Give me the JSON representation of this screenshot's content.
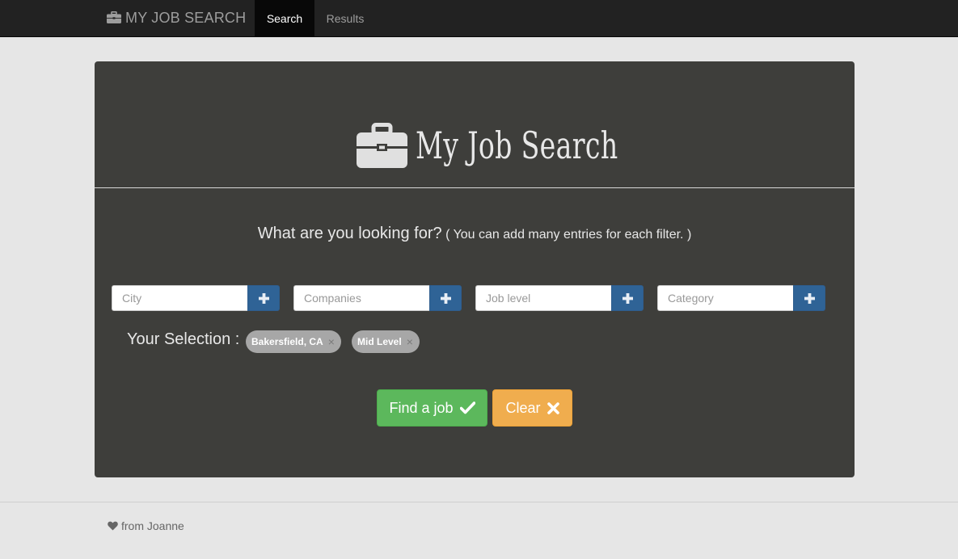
{
  "navbar": {
    "brand": "MY JOB SEARCH",
    "brand_icon": "briefcase-icon",
    "tabs": [
      {
        "label": "Search",
        "active": true
      },
      {
        "label": "Results",
        "active": false
      }
    ]
  },
  "hero": {
    "logo_text": "My Job Search",
    "logo_icon": "briefcase-icon"
  },
  "question": {
    "main": "What are you looking for?",
    "hint": "( You can add many entries for each filter. )"
  },
  "filters": [
    {
      "placeholder": "City",
      "value": "",
      "button_icon": "plus-icon"
    },
    {
      "placeholder": "Companies",
      "value": "",
      "button_icon": "plus-icon"
    },
    {
      "placeholder": "Job level",
      "value": "",
      "button_icon": "plus-icon"
    },
    {
      "placeholder": "Category",
      "value": "",
      "button_icon": "plus-icon"
    }
  ],
  "selection": {
    "label": "Your Selection :",
    "chips": [
      {
        "label": "Bakersfield, CA",
        "remove": "×"
      },
      {
        "label": "Mid Level",
        "remove": "×"
      }
    ]
  },
  "actions": {
    "find_label": "Find a job",
    "find_icon": "check-icon",
    "clear_label": "Clear",
    "clear_icon": "close-icon"
  },
  "footer": {
    "text": "from Joanne",
    "icon": "heart-icon"
  },
  "colors": {
    "navbar": "#222222",
    "panel": "#3e3e3b",
    "add_button": "#2f6396",
    "find_button": "#5cb85c",
    "clear_button": "#f0ad4e",
    "chip": "#a7a7a7"
  }
}
